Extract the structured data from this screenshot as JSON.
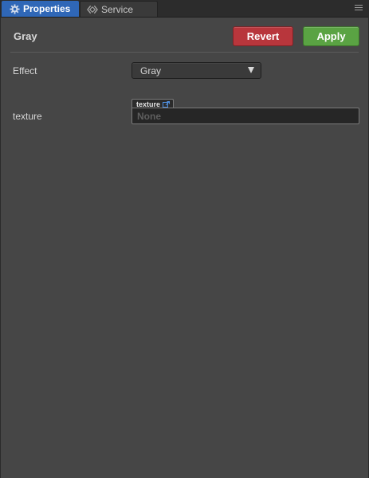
{
  "tabs": {
    "properties": {
      "label": "Properties",
      "icon": "gear-icon",
      "active": true
    },
    "service": {
      "label": "Service",
      "icon": "service-icon",
      "active": false
    },
    "menu_icon": "hamburger-menu-icon"
  },
  "header": {
    "asset_name": "Gray",
    "revert_label": "Revert",
    "apply_label": "Apply"
  },
  "properties": {
    "effect": {
      "label": "Effect",
      "value": "Gray"
    },
    "texture": {
      "label": "texture",
      "tag_label": "texture",
      "tag_icon": "external-link-icon",
      "value": "None"
    }
  },
  "colors": {
    "panel_bg": "#464646",
    "tab_active": "#2f67b7",
    "revert": "#b8363c",
    "apply": "#5aa343"
  }
}
